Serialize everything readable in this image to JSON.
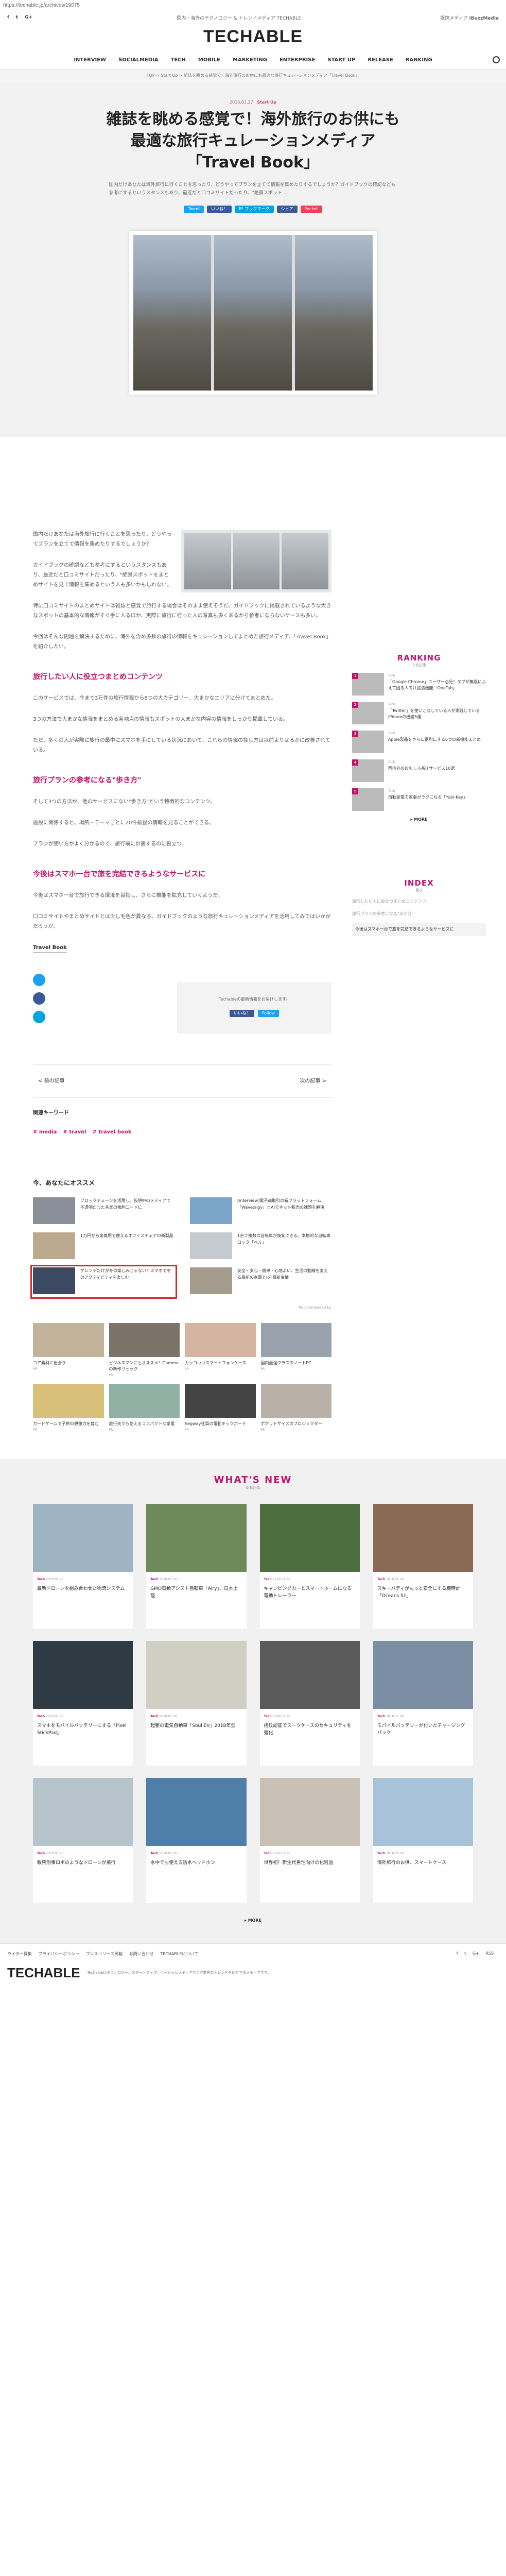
{
  "url": "https://techable.jp/archives/19075",
  "topbar": {
    "social": [
      "f",
      "t",
      "G+"
    ],
    "center": "国内・海外のテクノロジー & トレンドメディア TECHABLE",
    "right_label": "提携メディア",
    "right_brand": "iBuzzMedia"
  },
  "logo": "TECHABLE",
  "nav": [
    "INTERVIEW",
    "SOCIALMEDIA",
    "TECH",
    "MOBILE",
    "MARKETING",
    "ENTERPRISE",
    "START UP",
    "RELEASE",
    "RANKING"
  ],
  "breadcrumb": "TOP  >  Start Up  >  雑誌を眺める感覚で！海外旅行のお供にも最適な旅行キュレーションメディア「Travel Book」",
  "article": {
    "date": "2016.03.27",
    "category": "Start Up",
    "title": "雑誌を眺める感覚で！海外旅行のお供にも最適な旅行キュレーションメディア「Travel Book」",
    "lead": "国内だけあなたは海外旅行に行くことを思ったり、どうやってプランを立てて情報を集めたりするでしょうか？ガイドブックの確認なども参考にするというスタンスもあり、最近だと口コミサイトだったり、\"絶景スポット ...",
    "share": [
      "Tweet",
      "いいね！",
      "B! ブックマーク",
      "シェア",
      "Pocket"
    ],
    "paragraphs": [
      "国内だけあなたは海外旅行に行くことを思ったり、どうやってプランを立てて情報を集めたりするでしょうか？",
      "ガイドブックの確認なども参考にするというスタンスもあり、最近だと口コミサイトだったり、\"絶景スポットをまとめサイトを見て情報を集めるという人も多いかもしれない。",
      "特に口コミサイトのまとめサイトは雑誌と感覚で旅行する場合はそのまま使えそうだ。ガイドブックに掲載されているような大きなスポットの基本的な情報がすぐ手に入るほか、実際に旅行に行った人の写真も多くあるから参考にならないケースも多い。",
      "今回はそんな問題を解決するために、海外を含め多数の旅行の情報をキュレーションしてまとめた旅行メディア、「Travel Book」を紹介したい。",
      "このサービスでは、今まで3万件の旅行情報から8つの大カテゴリー、大まかなエリアに分けてまとめた。",
      "3つの方法で大まかな情報をまとめる各地点の情報もスポットの大まかな内容の情報をしっかり掲載している。",
      "ただ、多くの人が実際に旅行の最中にスマホを手にしている状況において、これらの情報の探し方は以前よりはるかに改善されている。",
      "そして3つの方法が、他のサービスにない\"歩き方\"という特徴的なコンテンツ。",
      "施設に関係すると、場所・テーマごとに20件前後の情報を見ることができる。",
      "プランが使い方がよく分かるので、旅行前に計画するのに役立つ。",
      "今後はスマホ一台で旅行できる環境を目指し、さらに機能を拡充していくようだ。",
      "口コミサイトやまとめサイトとは少し毛色が異なる、ガイドブックのような旅行キュレーションメディアを活用してみてはいかがだろうか。"
    ],
    "headings": [
      "旅行したい人に役立つまとめコンテンツ",
      "旅行プランの参考になる\"歩き方\"",
      "今後はスマホ一台で旅を完結できるようなサービスに"
    ],
    "source_link": "Travel Book",
    "follow_text": "Techableの最新情報をお届けします。",
    "follow_btns": [
      "いいね！",
      "Follow"
    ],
    "prev": "前の記事",
    "next": "次の記事",
    "keywords_label": "関連キーワード",
    "tags": [
      "# media",
      "# travel",
      "# travel book"
    ]
  },
  "sidebar": {
    "ranking_title": "RANKING",
    "ranking_sub": "人気記事",
    "ranking": [
      {
        "cat": "Tech",
        "title": "「Google Chrome」ユーザー必見！タブが無限にふえて困る人向け拡張機能「OneTab」"
      },
      {
        "cat": "Tech",
        "title": "「Twitter」を使いこなしている人が実践しているiPhoneの機能5選"
      },
      {
        "cat": "Tech",
        "title": "Apple製品をさらに便利にする6つの新機能まとめ"
      },
      {
        "cat": "Tech",
        "title": "国内外のおもしろ系ITサービス10選"
      },
      {
        "cat": "Tech",
        "title": "自動家電で家事がラクになる「Yubi-Key」"
      }
    ],
    "more": "MORE",
    "index_title": "INDEX",
    "index_sub": "目次",
    "index": [
      "旅行したい人に役立つまとめコンテンツ",
      "旅行プランの参考になる\"歩き方\"",
      "今後はスマホ一台で旅を完結できるようなサービスに"
    ]
  },
  "recommend": {
    "title": "今、あなたにオススメ",
    "items": [
      "ブロックチェーンを活用し、仮想中のメディアで不透明だった音楽の権利コードに",
      "[interview]電子商取引の新プラットフォーム「Waveoligy」とAIでネット販売の課題を解決",
      "1万円から家庭用で使えるオフィスチェアの新製品",
      "1台で複数の自転車が施錠できる、本格的な自転車ロック「ベル」",
      "ゲレンデだけが冬の楽しみじゃない！スマホで冬のアクティビティを楽しむ",
      "安全・安心・簡単・心地よい、生活の動線を変える最新の家電とIoT最新事情"
    ],
    "ad_credit": "Recommended by",
    "ads": [
      {
        "title": "コア素材に出会う",
        "src": "PR"
      },
      {
        "title": "ビジネスマンにもオススメ！Gammoの新作リュック",
        "src": "PR"
      },
      {
        "title": "カッコいいスマートフォンケース",
        "src": "PR"
      },
      {
        "title": "国内最強クラスのノートPC",
        "src": "PR"
      },
      {
        "title": "カードゲームで子供の想像力を育む",
        "src": "PR"
      },
      {
        "title": "旅行先でも使えるコンパクトな家電",
        "src": "PR"
      },
      {
        "title": "Segway社製の電動キックボード",
        "src": "PR"
      },
      {
        "title": "ポケットサイズのプロジェクター",
        "src": "PR"
      }
    ]
  },
  "whatsnew": {
    "title": "WHAT'S NEW",
    "sub": "新着記事",
    "items": [
      {
        "cat": "Tech",
        "date": "2018.01.26",
        "title": "最新ドローンを組み合わせた物流システム"
      },
      {
        "cat": "Tech",
        "date": "2018.01.26",
        "title": "GMO電動アシスト自転車「Airy」、日本上陸"
      },
      {
        "cat": "Tech",
        "date": "2018.01.26",
        "title": "キャンピングカーとスマートホームになる電動トレーラー"
      },
      {
        "cat": "Tech",
        "date": "2018.01.26",
        "title": "スキーバディがもっと安全にする腕時計「Oceans S1」"
      },
      {
        "cat": "Tech",
        "date": "2018.01.26",
        "title": "スマホをモバイルバッテリーにする「Pixel StickPad」"
      },
      {
        "cat": "Tech",
        "date": "2018.01.26",
        "title": "起亜の電気自動車「Soul EV」2018年型"
      },
      {
        "cat": "Tech",
        "date": "2018.01.26",
        "title": "指紋認証でスーツケースのセキュリティを強化"
      },
      {
        "cat": "Tech",
        "date": "2018.01.26",
        "title": "モバイルバッテリーが付いたチャージングパック"
      },
      {
        "cat": "Tech",
        "date": "2018.01.26",
        "title": "敏腕刑事ロボのようなドローンが飛行"
      },
      {
        "cat": "Tech",
        "date": "2018.01.26",
        "title": "水中でも使える防水ヘッドホン"
      },
      {
        "cat": "Tech",
        "date": "2018.01.26",
        "title": "世界初！新生代男性向けの化粧品"
      },
      {
        "cat": "Tech",
        "date": "2018.01.26",
        "title": "海外旅行のお供、スマートケース"
      }
    ],
    "more": "MORE"
  },
  "footer": {
    "links": [
      "ライター募集",
      "プライバシーポリシー",
      "プレスリリース掲載",
      "お問い合わせ",
      "TECHABLEについて"
    ],
    "social": [
      "f",
      "t",
      "G+",
      "RSS"
    ],
    "logo": "TECHABLE",
    "about": "Techableはテクノロジー、スタートアップ、ソーシャルメディアなどIT業界のトレンドを紹介するメディアです。"
  }
}
